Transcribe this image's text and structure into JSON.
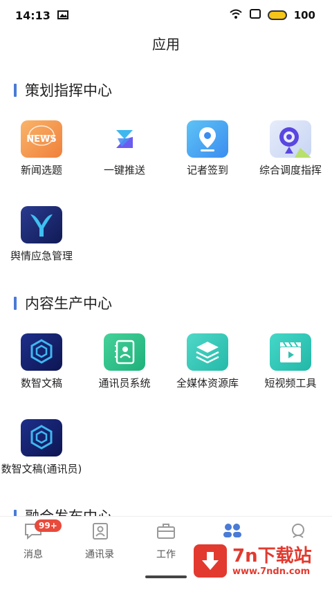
{
  "status_bar": {
    "time": "14:13",
    "battery": "100"
  },
  "page": {
    "title": "应用"
  },
  "sections": [
    {
      "title": "策划指挥中心",
      "apps": [
        {
          "label": "新闻选题",
          "icon": "news-icon",
          "icon_text": "NEWS"
        },
        {
          "label": "一键推送",
          "icon": "push-icon"
        },
        {
          "label": "记者签到",
          "icon": "location-pin-icon"
        },
        {
          "label": "综合调度指挥",
          "icon": "dispatch-icon"
        },
        {
          "label": "舆情应急管理",
          "icon": "opinion-icon"
        }
      ]
    },
    {
      "title": "内容生产中心",
      "apps": [
        {
          "label": "数智文稿",
          "icon": "cube-icon"
        },
        {
          "label": "通讯员系统",
          "icon": "contact-card-icon"
        },
        {
          "label": "全媒体资源库",
          "icon": "layers-icon"
        },
        {
          "label": "短视频工具",
          "icon": "clapperboard-icon"
        },
        {
          "label": "数智文稿(通讯员)",
          "icon": "cube-icon"
        }
      ]
    },
    {
      "title": "融合发布中心",
      "apps": []
    }
  ],
  "bottom_nav": [
    {
      "label": "消息",
      "icon": "message-icon",
      "badge": "99+"
    },
    {
      "label": "通讯录",
      "icon": "contacts-icon"
    },
    {
      "label": "工作",
      "icon": "briefcase-icon"
    },
    {
      "label": "",
      "icon": "apps-icon"
    },
    {
      "label": "",
      "icon": "search-icon"
    }
  ],
  "watermark": {
    "title": "7n下载站",
    "url": "www.7ndn.com"
  },
  "colors": {
    "accent": "#4a7bd6",
    "badge": "#e84a3b",
    "watermark": "#e23a2f"
  }
}
